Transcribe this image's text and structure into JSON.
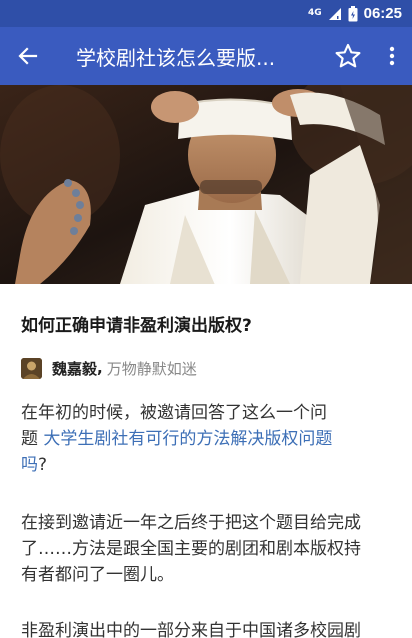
{
  "status_bar": {
    "network": "4G",
    "time": "06:25"
  },
  "toolbar": {
    "title": "学校剧社该怎么要版...",
    "back_icon": "arrow-left-icon",
    "star_icon": "star-outline-icon",
    "more_icon": "more-vertical-icon"
  },
  "question": {
    "title": "如何正确申请非盈利演出版权?"
  },
  "author": {
    "name": "魏嘉毅",
    "separator": ",",
    "signature": "万物静默如迷"
  },
  "paragraphs": {
    "p1_line1": "在年初的时候，被邀请回答了这么一个问",
    "p1_prefix": "题 ",
    "p1_link_line2": "大学生剧社有可行的方法解决版权问题",
    "p1_link_line3": "吗",
    "p1_suffix": "?",
    "p2_line1": "在接到邀请近一年之后终于把这个题目给完成",
    "p2_line2": "了……方法是跟全国主要的剧团和剧本版权持",
    "p2_line3": "有者都问了一圈儿。",
    "p3_line1": "非盈利演出中的一部分来自于中国诸多校园剧"
  },
  "colors": {
    "status_bar": "#2f4fa8",
    "app_bar": "#3a5bbf",
    "link": "#3d6fb6"
  }
}
